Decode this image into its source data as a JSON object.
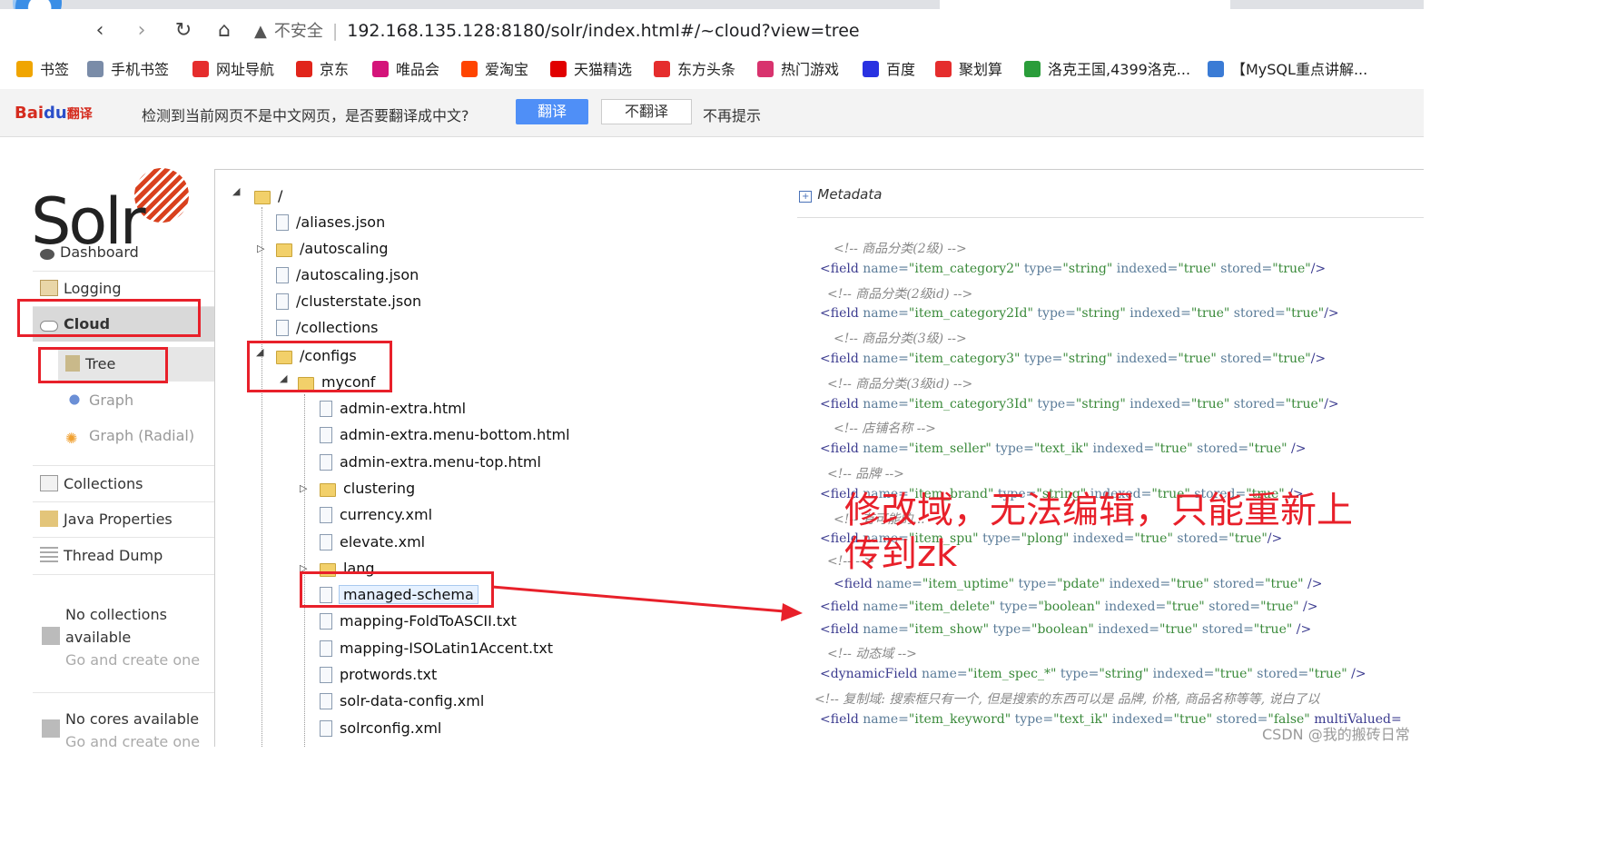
{
  "browser": {
    "security": "不安全",
    "url": "192.168.135.128:8180/solr/index.html#/~cloud?view=tree"
  },
  "bookmarks": [
    {
      "label": "书签",
      "color": "#f0a500"
    },
    {
      "label": "手机书签",
      "color": "#7a8ca8"
    },
    {
      "label": "网址导航",
      "color": "#e52d2d"
    },
    {
      "label": "京东",
      "color": "#e1251b"
    },
    {
      "label": "唯品会",
      "color": "#d4147a"
    },
    {
      "label": "爱淘宝",
      "color": "#ff4400"
    },
    {
      "label": "天猫精选",
      "color": "#e10000"
    },
    {
      "label": "东方头条",
      "color": "#e52d2d"
    },
    {
      "label": "热门游戏",
      "color": "#d8336e"
    },
    {
      "label": "百度",
      "color": "#2932e1"
    },
    {
      "label": "聚划算",
      "color": "#e52d2d"
    },
    {
      "label": "洛克王国,4399洛克...",
      "color": "#2a9d3a"
    },
    {
      "label": "【MySQL重点讲解...",
      "color": "#3a7bd5"
    }
  ],
  "translate_bar": {
    "logo": "Bai",
    "logo_du": "du",
    "logo_suffix": "翻译",
    "message": "检测到当前网页不是中文网页，是否要翻译成中文?",
    "translate": "翻译",
    "no_translate": "不翻译",
    "no_more": "不再提示"
  },
  "solr": {
    "logo": "Solr",
    "nav": {
      "dashboard": "Dashboard",
      "logging": "Logging",
      "cloud": "Cloud",
      "tree": "Tree",
      "graph": "Graph",
      "graph_radial": "Graph (Radial)",
      "collections": "Collections",
      "java_properties": "Java Properties",
      "thread_dump": "Thread Dump"
    },
    "no_collections": "No collections available",
    "no_cores": "No cores available",
    "go_create": "Go and create one"
  },
  "tree": {
    "root": "/",
    "root_items": [
      "/aliases.json",
      "/autoscaling",
      "/autoscaling.json",
      "/clusterstate.json",
      "/collections"
    ],
    "configs": "/configs",
    "myconf": "myconf",
    "myconf_items": [
      "admin-extra.html",
      "admin-extra.menu-bottom.html",
      "admin-extra.menu-top.html",
      "clustering",
      "currency.xml",
      "elevate.xml",
      "lang",
      "managed-schema",
      "mapping-FoldToASCII.txt",
      "mapping-ISOLatin1Accent.txt",
      "protwords.txt",
      "solr-data-config.xml",
      "solrconfig.xml"
    ]
  },
  "metadata": {
    "heading": "Metadata",
    "lines": [
      {
        "kind": "comment",
        "text": "<!-- 商品分类(2级) -->"
      },
      {
        "kind": "field",
        "name": "item_category2",
        "type": "string",
        "indexed": "true",
        "stored": "true",
        "close": "/>"
      },
      {
        "kind": "comment",
        "text": "<!-- 商品分类(2级id) -->"
      },
      {
        "kind": "field",
        "name": "item_category2Id",
        "type": "string",
        "indexed": "true",
        "stored": "true",
        "close": "/>"
      },
      {
        "kind": "comment",
        "text": "<!-- 商品分类(3级) -->"
      },
      {
        "kind": "field",
        "name": "item_category3",
        "type": "string",
        "indexed": "true",
        "stored": "true",
        "close": "/>"
      },
      {
        "kind": "comment",
        "text": "<!-- 商品分类(3级id) -->"
      },
      {
        "kind": "field",
        "name": "item_category3Id",
        "type": "string",
        "indexed": "true",
        "stored": "true",
        "close": "/>"
      },
      {
        "kind": "comment",
        "text": "<!-- 店铺名称 -->"
      },
      {
        "kind": "field",
        "name": "item_seller",
        "type": "text_ik",
        "indexed": "true",
        "stored": "true",
        "close": " />"
      },
      {
        "kind": "comment",
        "text": "<!-- 品牌 -->"
      },
      {
        "kind": "field",
        "name": "item_brand",
        "type": "string",
        "indexed": "true",
        "stored": "true",
        "close": " />"
      },
      {
        "kind": "comment",
        "text": "<!-- 有可能的..."
      },
      {
        "kind": "field",
        "name": "item_spu",
        "type": "plong",
        "indexed": "true",
        "stored": "true",
        "close": "/>"
      },
      {
        "kind": "comment",
        "text": "<!-- -->"
      },
      {
        "kind": "field",
        "name": "item_uptime",
        "type": "pdate",
        "indexed": "true",
        "stored": "true",
        "close": " />"
      },
      {
        "kind": "field",
        "name": "item_delete",
        "type": "boolean",
        "indexed": "true",
        "stored": "true",
        "close": " />"
      },
      {
        "kind": "field",
        "name": "item_show",
        "type": "boolean",
        "indexed": "true",
        "stored": "true",
        "close": " />"
      },
      {
        "kind": "comment",
        "text": "<!-- 动态域 -->"
      },
      {
        "kind": "dynamic",
        "name": "item_spec_*",
        "type": "string",
        "indexed": "true",
        "stored": "true",
        "close": " />"
      },
      {
        "kind": "comment",
        "text": "<!-- 复制域: 搜索框只有一个, 但是搜索的东西可以是 品牌, 价格, 商品名称等等, 说白了以"
      },
      {
        "kind": "field",
        "name": "item_keyword",
        "type": "text_ik",
        "indexed": "true",
        "stored": "false",
        "close": " multiValued="
      }
    ]
  },
  "annotation": {
    "text_line1": "修改域，无法编辑，只能重新上",
    "text_line2": "传到zk"
  },
  "watermark": "CSDN @我的搬砖日常",
  "colors": {
    "annotation_red": "#e8202a",
    "translate_blue": "#4f8ff7"
  }
}
